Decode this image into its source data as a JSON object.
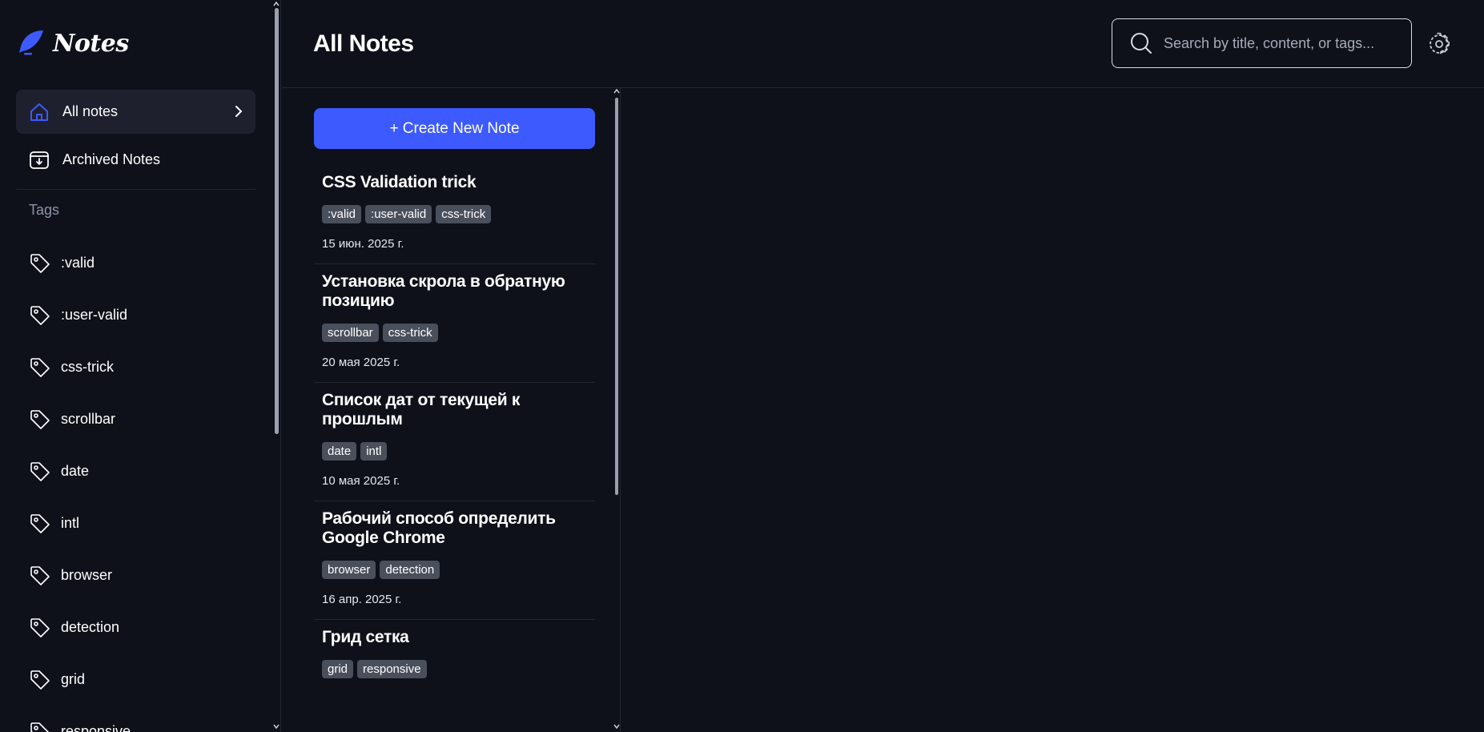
{
  "app": {
    "logo_text": "Notes",
    "accent": "#3d5afe"
  },
  "sidebar": {
    "nav": [
      {
        "label": "All notes",
        "icon": "home-icon",
        "active": true
      },
      {
        "label": "Archived Notes",
        "icon": "archive-icon",
        "active": false
      }
    ],
    "tags_title": "Tags",
    "tags": [
      ":valid",
      ":user-valid",
      "css-trick",
      "scrollbar",
      "date",
      "intl",
      "browser",
      "detection",
      "grid",
      "responsive"
    ]
  },
  "header": {
    "title": "All Notes",
    "search_placeholder": "Search by title, content, or tags...",
    "settings_icon": "gear-icon"
  },
  "notes_panel": {
    "create_label": "+ Create New Note",
    "notes": [
      {
        "title": "CSS Validation trick",
        "tags": [
          ":valid",
          ":user-valid",
          "css-trick"
        ],
        "date": "15 июн. 2025 г."
      },
      {
        "title": "Установка скрола в обратную позицию",
        "tags": [
          "scrollbar",
          "css-trick"
        ],
        "date": "20 мая 2025 г."
      },
      {
        "title": "Список дат от текущей к прошлым",
        "tags": [
          "date",
          "intl"
        ],
        "date": "10 мая 2025 г."
      },
      {
        "title": "Рабочий способ определить Google Chrome",
        "tags": [
          "browser",
          "detection"
        ],
        "date": "16 апр. 2025 г."
      },
      {
        "title": "Грид сетка",
        "tags": [
          "grid",
          "responsive"
        ],
        "date": ""
      }
    ]
  }
}
